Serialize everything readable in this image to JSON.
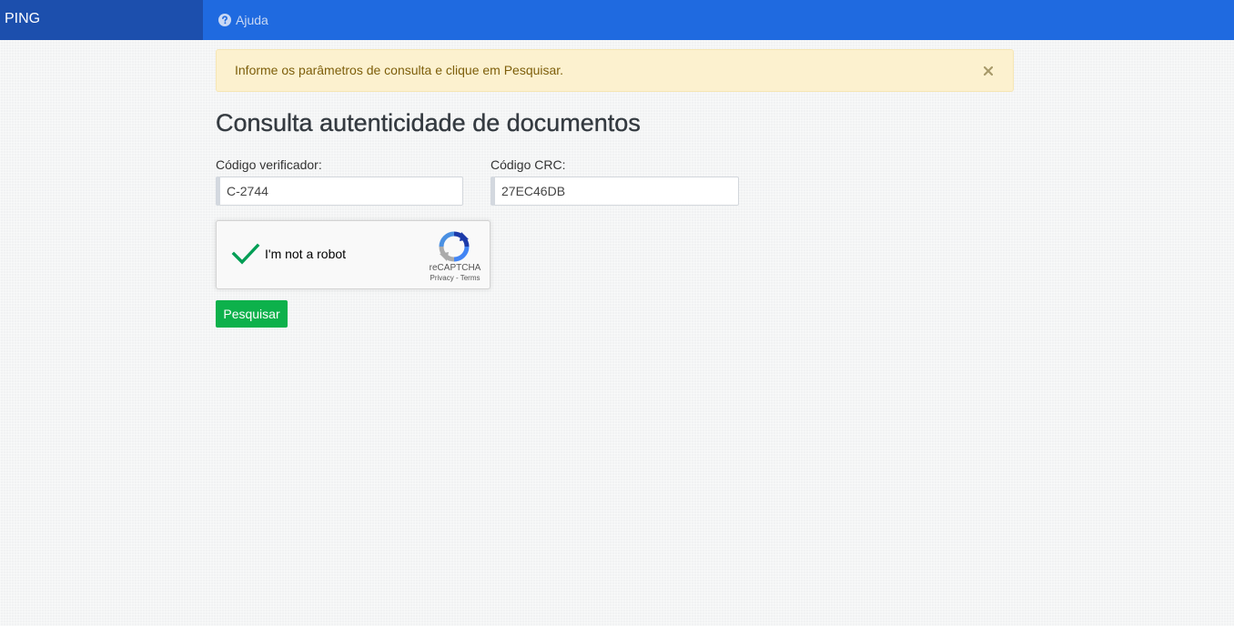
{
  "header": {
    "brand": "PING",
    "help_label": "Ajuda"
  },
  "alert": {
    "message": "Informe os parâmetros de consulta e clique em Pesquisar."
  },
  "page": {
    "title": "Consulta autenticidade de documentos"
  },
  "form": {
    "verifier_label": "Código verificador:",
    "verifier_value": "C-2744",
    "crc_label": "Código CRC:",
    "crc_value": "27EC46DB",
    "submit_label": "Pesquisar"
  },
  "recaptcha": {
    "label": "I'm not a robot",
    "checked": true,
    "brand": "reCAPTCHA",
    "privacy": "Privacy",
    "separator": " - ",
    "terms": "Terms"
  },
  "colors": {
    "navbar": "#1f6ae0",
    "brand_bg": "#1c4fad",
    "alert_bg": "#fcf1cf",
    "button": "#0db14b",
    "check": "#009e55"
  }
}
